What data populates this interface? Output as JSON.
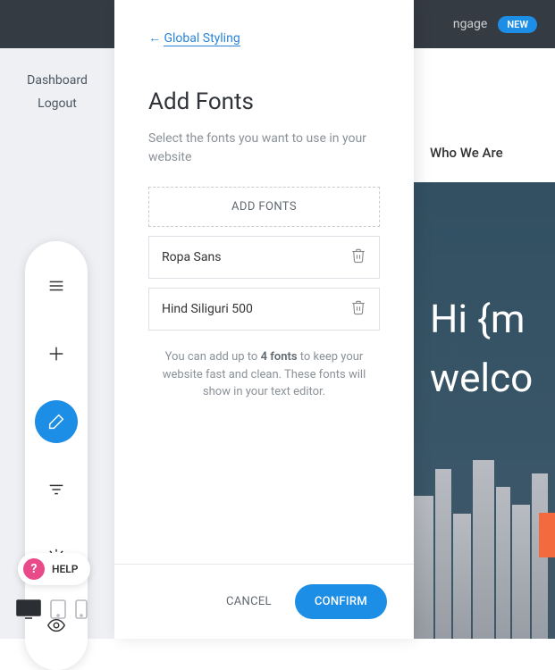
{
  "topbar": {
    "engage": "ngage",
    "new_badge": "NEW"
  },
  "left_nav": {
    "dashboard": "Dashboard",
    "logout": "Logout"
  },
  "help": {
    "label": "HELP",
    "icon": "?"
  },
  "panel": {
    "back": "Global Styling",
    "back_arrow": "←",
    "title": "Add Fonts",
    "subtitle": "Select the fonts you want to use in your website",
    "add_button": "ADD FONTS",
    "fonts": [
      "Ropa Sans",
      "Hind Siliguri 500"
    ],
    "hint_pre": "You can add up to ",
    "hint_bold": "4 fonts",
    "hint_post": " to keep your website fast and clean. These fonts will show in your text editor.",
    "cancel": "CANCEL",
    "confirm": "CONFIRM"
  },
  "preview": {
    "nav": [
      "Who We Are"
    ],
    "hero_line1": "Hi {m",
    "hero_line2": "welco"
  }
}
